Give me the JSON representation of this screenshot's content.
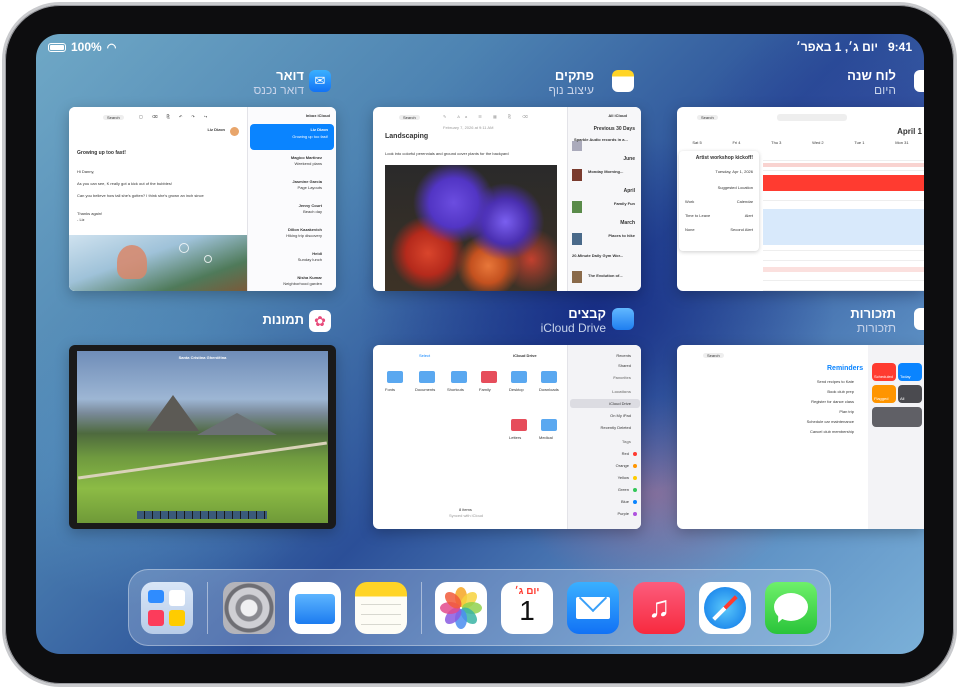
{
  "status_bar": {
    "time": "9:41",
    "date": "יום ג׳, 1 באפר׳",
    "battery": "100%"
  },
  "apps_row1": [
    {
      "name": "לוח שנה",
      "sub": "היום"
    },
    {
      "name": "פתקים",
      "sub": "עיצוב נוף"
    },
    {
      "name": "דואר",
      "sub": "דואר נכנס"
    }
  ],
  "apps_row2": [
    {
      "name": "תזכורות",
      "sub": "תזכורות"
    },
    {
      "name": "קבצים",
      "sub": "iCloud Drive"
    },
    {
      "name": "תמונות",
      "sub": ""
    }
  ],
  "mail": {
    "search": "Search",
    "mailbox": "Inbox iCloud",
    "subject": "Growing up too fast!",
    "sender": "Liz Dizon",
    "body1": "Hi Danny,",
    "body2": "As you can see, K really got a kick out of the bubbles!",
    "body3": "Can you believe how tall she's gotten? I think she's grown an inch since",
    "body4": "Thanks again!",
    "sig": "- Liz",
    "list": [
      {
        "from": "Liz Dizon",
        "preview": "Growing up too fast!"
      },
      {
        "from": "Magico Martinez",
        "preview": "Weekend plans"
      },
      {
        "from": "Jasmine Garcia",
        "preview": "Page Layouts"
      },
      {
        "from": "Jenny Court",
        "preview": "Beach day"
      },
      {
        "from": "Dillon Kazakevich",
        "preview": "Hiking trip discovery"
      },
      {
        "from": "Heidi",
        "preview": "Sunday lunch"
      },
      {
        "from": "Nisha Kumar",
        "preview": "Neighborhood garden"
      }
    ]
  },
  "notes": {
    "search": "Search",
    "title": "Landscaping",
    "date": "February 7, 2026 at 9:11 AM",
    "body": "Look into colorful perennials and ground cover plants for the backyard",
    "header": "All iCloud",
    "section": "Previous 30 Days",
    "items": [
      {
        "title": "Sparkle Audio records in a...",
        "meta": "Notes"
      },
      {
        "title": "June",
        "meta": ""
      },
      {
        "title": "Monday Morning...",
        "meta": "Notes"
      },
      {
        "title": "April",
        "meta": ""
      },
      {
        "title": "Family Fun",
        "meta": "Notes"
      },
      {
        "title": "March",
        "meta": ""
      },
      {
        "title": "Places to hike",
        "meta": "Notes"
      },
      {
        "title": "20-Minute Daily Gym Wor...",
        "meta": "Notes"
      },
      {
        "title": "The Evolution of...",
        "meta": "Notes"
      }
    ]
  },
  "calendar": {
    "search": "Search",
    "month": "April 1",
    "event": "Artist workshop kickoff!",
    "event_date": "Tuesday, Apr 1, 2026",
    "rows": [
      {
        "label": "Suggested Location",
        "value": ""
      },
      {
        "label": "Work",
        "value": "Calendar"
      },
      {
        "label": "Time to Leave",
        "value": "Alert"
      },
      {
        "label": "None",
        "value": "Second Alert"
      }
    ],
    "days": [
      "Sat 5",
      "Fri 4",
      "Thu 3",
      "Wed 2",
      "Tue 1",
      "Mon 31"
    ]
  },
  "reminders": {
    "search": "Search",
    "title": "Reminders",
    "items": [
      "Send recipes to Kate",
      "Book club prep",
      "Register for dance class",
      "Plan trip",
      "Schedule car maintenance",
      "Cancel club membership"
    ],
    "tiles": [
      "Scheduled",
      "Today",
      "Flagged",
      "All"
    ]
  },
  "files": {
    "title": "iCloud Drive",
    "select": "Select",
    "folders": [
      {
        "name": "Fonts",
        "meta": "1 item"
      },
      {
        "name": "Documents",
        "meta": "3 items"
      },
      {
        "name": "Shortcuts",
        "meta": "1 item"
      },
      {
        "name": "Family",
        "meta": "12 items"
      },
      {
        "name": "Desktop",
        "meta": "1 item"
      },
      {
        "name": "Downloads",
        "meta": "3 items"
      },
      {
        "name": "Letters",
        "meta": "5 items"
      },
      {
        "name": "Medical",
        "meta": "4 items"
      }
    ],
    "footer": "8 items",
    "footer2": "Synced with iCloud",
    "sidebar": [
      "Recents",
      "Shared",
      "Favorites",
      "Locations",
      "iCloud Drive",
      "On My iPad",
      "Recently Deleted",
      "Tags",
      "Red",
      "Orange",
      "Yellow",
      "Green",
      "Blue",
      "Purple"
    ]
  },
  "photos": {
    "title": "Santa Cristina Gherdëina"
  },
  "dock": {
    "calendar_weekday": "יום ג׳",
    "calendar_day": "1"
  },
  "colors": {
    "accent": "#0a84ff",
    "red": "#ff3b30"
  }
}
